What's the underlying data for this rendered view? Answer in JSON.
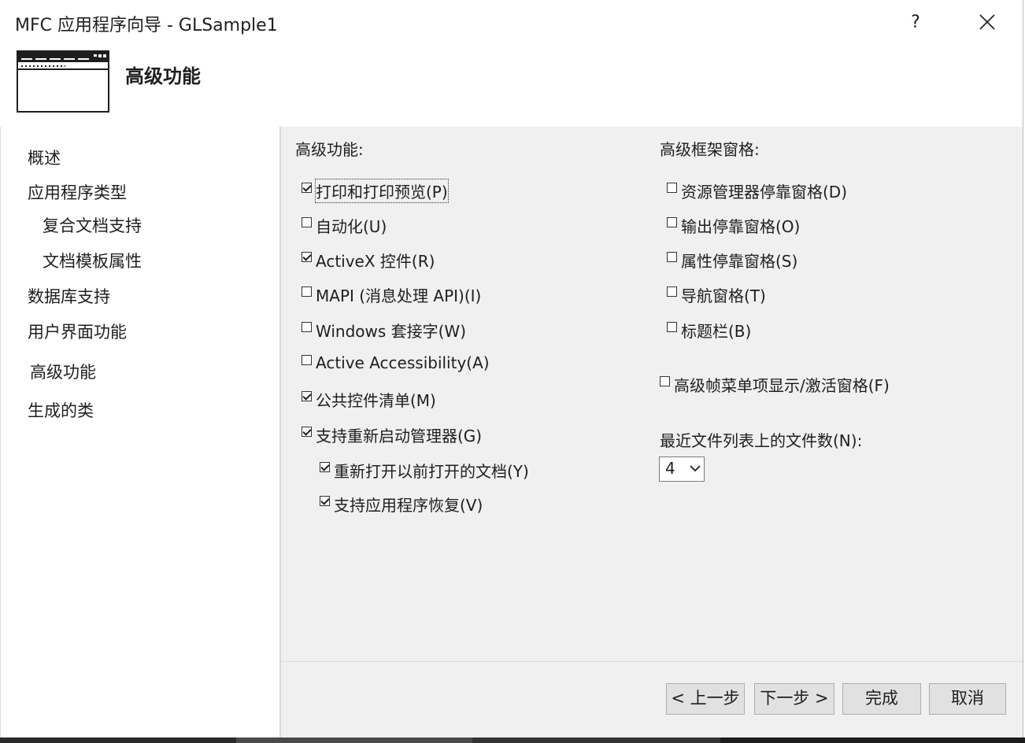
{
  "window": {
    "title": "MFC 应用程序向导 - GLSample1",
    "help_label": "?"
  },
  "header": {
    "title": "高级功能"
  },
  "nav": {
    "items": [
      {
        "label": "概述"
      },
      {
        "label": "应用程序类型"
      },
      {
        "label": "复合文档支持"
      },
      {
        "label": "文档模板属性"
      },
      {
        "label": "数据库支持"
      },
      {
        "label": "用户界面功能"
      },
      {
        "label": "高级功能"
      },
      {
        "label": "生成的类"
      }
    ]
  },
  "advanced_features": {
    "label": "高级功能:",
    "options": [
      {
        "label": "打印和打印预览(P)",
        "checked": true
      },
      {
        "label": "自动化(U)",
        "checked": false
      },
      {
        "label": "ActiveX 控件(R)",
        "checked": true
      },
      {
        "label": "MAPI (消息处理 API)(I)",
        "checked": false
      },
      {
        "label": "Windows 套接字(W)",
        "checked": false
      },
      {
        "label": "Active Accessibility(A)",
        "checked": false
      },
      {
        "label": "公共控件清单(M)",
        "checked": true
      },
      {
        "label": "支持重新启动管理器(G)",
        "checked": true
      },
      {
        "label": "重新打开以前打开的文档(Y)",
        "checked": true
      },
      {
        "label": "支持应用程序恢复(V)",
        "checked": true
      }
    ]
  },
  "advanced_frame_panes": {
    "label": "高级框架窗格:",
    "options": [
      {
        "label": "资源管理器停靠窗格(D)",
        "checked": false
      },
      {
        "label": "输出停靠窗格(O)",
        "checked": false
      },
      {
        "label": "属性停靠窗格(S)",
        "checked": false
      },
      {
        "label": "导航窗格(T)",
        "checked": false
      },
      {
        "label": "标题栏(B)",
        "checked": false
      }
    ],
    "menu_option": {
      "label": "高级帧菜单项显示/激活窗格(F)",
      "checked": false
    }
  },
  "recent_files": {
    "label": "最近文件列表上的文件数(N):",
    "value": "4"
  },
  "buttons": {
    "prev": "< 上一步",
    "next": "下一步 >",
    "finish": "完成",
    "cancel": "取消"
  }
}
